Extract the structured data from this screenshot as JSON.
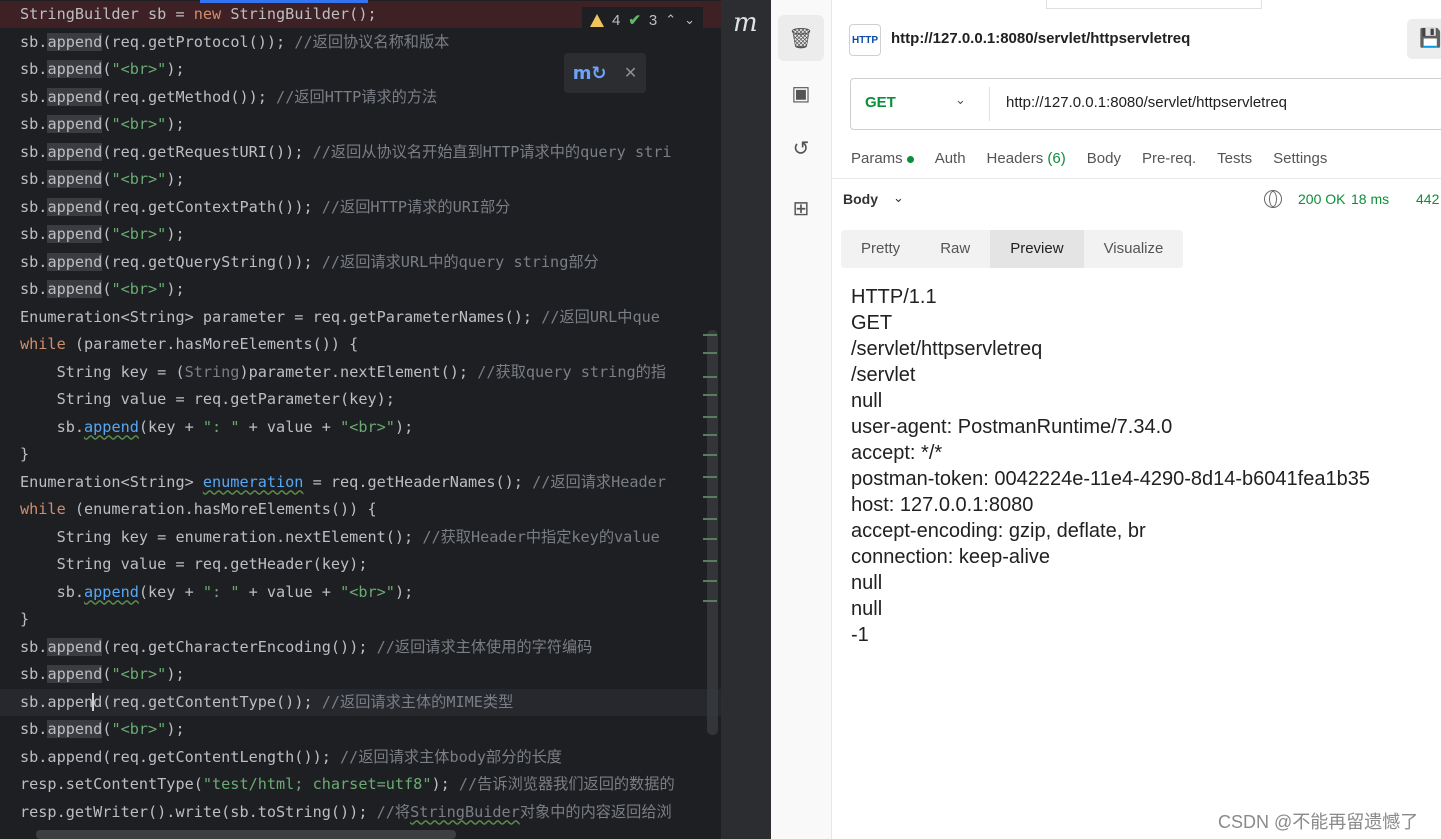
{
  "ide": {
    "inspections": {
      "warnings": "4",
      "weak_warnings": "3"
    },
    "popup": {
      "icon": "maven-refresh-icon"
    },
    "strip_label": "m"
  },
  "code_lines": [
    {
      "tokens": [
        {
          "t": "StringBuilder sb = "
        },
        {
          "t": "new",
          "c": "kw"
        },
        {
          "t": " StringBuilder();"
        }
      ]
    },
    {
      "tokens": [
        {
          "t": "sb."
        },
        {
          "t": "append",
          "c": "box"
        },
        {
          "t": "(req.getProtocol()); "
        },
        {
          "t": "//返回协议名称和版本",
          "c": "cm"
        }
      ]
    },
    {
      "tokens": [
        {
          "t": "sb."
        },
        {
          "t": "append",
          "c": "box"
        },
        {
          "t": "("
        },
        {
          "t": "\"<br>\"",
          "c": "str"
        },
        {
          "t": ");"
        }
      ]
    },
    {
      "tokens": [
        {
          "t": "sb."
        },
        {
          "t": "append",
          "c": "box"
        },
        {
          "t": "(req.getMethod()); "
        },
        {
          "t": "//返回HTTP请求的方法",
          "c": "cm"
        }
      ]
    },
    {
      "tokens": [
        {
          "t": "sb."
        },
        {
          "t": "append",
          "c": "box"
        },
        {
          "t": "("
        },
        {
          "t": "\"<br>\"",
          "c": "str"
        },
        {
          "t": ");"
        }
      ]
    },
    {
      "tokens": [
        {
          "t": "sb."
        },
        {
          "t": "append",
          "c": "box"
        },
        {
          "t": "(req.getRequestURI()); "
        },
        {
          "t": "//返回从协议名开始直到HTTP请求中的query stri",
          "c": "cm"
        }
      ]
    },
    {
      "tokens": [
        {
          "t": "sb."
        },
        {
          "t": "append",
          "c": "box"
        },
        {
          "t": "("
        },
        {
          "t": "\"<br>\"",
          "c": "str"
        },
        {
          "t": ");"
        }
      ]
    },
    {
      "tokens": [
        {
          "t": "sb."
        },
        {
          "t": "append",
          "c": "box"
        },
        {
          "t": "(req.getContextPath()); "
        },
        {
          "t": "//返回HTTP请求的URI部分",
          "c": "cm"
        }
      ]
    },
    {
      "tokens": [
        {
          "t": "sb."
        },
        {
          "t": "append",
          "c": "box"
        },
        {
          "t": "("
        },
        {
          "t": "\"<br>\"",
          "c": "str"
        },
        {
          "t": ");"
        }
      ]
    },
    {
      "tokens": [
        {
          "t": "sb."
        },
        {
          "t": "append",
          "c": "box"
        },
        {
          "t": "(req.getQueryString()); "
        },
        {
          "t": "//返回请求URL中的query string部分",
          "c": "cm"
        }
      ]
    },
    {
      "tokens": [
        {
          "t": "sb."
        },
        {
          "t": "append",
          "c": "box"
        },
        {
          "t": "("
        },
        {
          "t": "\"<br>\"",
          "c": "str"
        },
        {
          "t": ");"
        }
      ]
    },
    {
      "tokens": [
        {
          "t": "Enumeration<String> parameter = req.getParameterNames(); "
        },
        {
          "t": "//返回URL中que",
          "c": "cm"
        }
      ]
    },
    {
      "tokens": [
        {
          "t": "while",
          "c": "kw"
        },
        {
          "t": " (parameter.hasMoreElements()) {"
        }
      ]
    },
    {
      "tokens": [
        {
          "t": "    String key = ("
        },
        {
          "t": "String",
          "c": "gr"
        },
        {
          "t": ")parameter.nextElement(); "
        },
        {
          "t": "//获取query string的指",
          "c": "cm"
        }
      ]
    },
    {
      "tokens": [
        {
          "t": "    String value = req.getParameter(key);"
        }
      ]
    },
    {
      "tokens": [
        {
          "t": "    sb."
        },
        {
          "t": "append",
          "c": "ul"
        },
        {
          "t": "(key + "
        },
        {
          "t": "\": \"",
          "c": "str"
        },
        {
          "t": " + value + "
        },
        {
          "t": "\"<br>\"",
          "c": "str"
        },
        {
          "t": ");"
        }
      ]
    },
    {
      "tokens": [
        {
          "t": "}"
        }
      ]
    },
    {
      "tokens": [
        {
          "t": "Enumeration<String> "
        },
        {
          "t": "enumeration",
          "c": "ul"
        },
        {
          "t": " = req.getHeaderNames(); "
        },
        {
          "t": "//返回请求Header",
          "c": "cm"
        }
      ]
    },
    {
      "tokens": [
        {
          "t": "while",
          "c": "kw"
        },
        {
          "t": " (enumeration.hasMoreElements()) {"
        }
      ]
    },
    {
      "tokens": [
        {
          "t": "    String key = enumeration.nextElement(); "
        },
        {
          "t": "//获取Header中指定key的value",
          "c": "cm"
        }
      ]
    },
    {
      "tokens": [
        {
          "t": "    String value = req.getHeader(key);"
        }
      ]
    },
    {
      "tokens": [
        {
          "t": "    sb."
        },
        {
          "t": "append",
          "c": "ul"
        },
        {
          "t": "(key + "
        },
        {
          "t": "\": \"",
          "c": "str"
        },
        {
          "t": " + value + "
        },
        {
          "t": "\"<br>\"",
          "c": "str"
        },
        {
          "t": ");"
        }
      ]
    },
    {
      "tokens": [
        {
          "t": "}"
        }
      ]
    },
    {
      "tokens": [
        {
          "t": "sb."
        },
        {
          "t": "append",
          "c": "box"
        },
        {
          "t": "(req.getCharacterEncoding()); "
        },
        {
          "t": "//返回请求主体使用的字符编码",
          "c": "cm"
        }
      ]
    },
    {
      "tokens": [
        {
          "t": "sb."
        },
        {
          "t": "append",
          "c": "box"
        },
        {
          "t": "("
        },
        {
          "t": "\"<br>\"",
          "c": "str"
        },
        {
          "t": ");"
        }
      ]
    },
    {
      "tokens": [
        {
          "t": "sb.appen"
        },
        {
          "t": "",
          "c": "caret"
        },
        {
          "t": "d(req.getContentType()); "
        },
        {
          "t": "//返回请求主体的MIME类型",
          "c": "cm"
        }
      ]
    },
    {
      "tokens": [
        {
          "t": "sb."
        },
        {
          "t": "append",
          "c": "box"
        },
        {
          "t": "("
        },
        {
          "t": "\"<br>\"",
          "c": "str"
        },
        {
          "t": ");"
        }
      ]
    },
    {
      "tokens": [
        {
          "t": "sb.append(req.getContentLength()); "
        },
        {
          "t": "//返回请求主体body部分的长度",
          "c": "cm"
        }
      ]
    },
    {
      "tokens": [
        {
          "t": "resp.setContentType("
        },
        {
          "t": "\"test/html; charset=utf8\"",
          "c": "str"
        },
        {
          "t": "); "
        },
        {
          "t": "//告诉浏览器我们返回的数据的",
          "c": "cm"
        }
      ]
    },
    {
      "tokens": [
        {
          "t": "resp.getWriter().write(sb.toString()); "
        },
        {
          "t": "//将",
          "c": "cm"
        },
        {
          "t": "StringBuider",
          "c": "cm-ul"
        },
        {
          "t": "对象中的内容返回给浏",
          "c": "cm"
        }
      ]
    }
  ],
  "postman": {
    "request_title": "http://127.0.0.1:8080/servlet/httpservletreq",
    "http_icon_label": "HTTP",
    "method": "GET",
    "url": "http://127.0.0.1:8080/servlet/httpservletreq",
    "tabs": {
      "params": "Params",
      "auth": "Auth",
      "headers": "Headers",
      "headers_count": "(6)",
      "body": "Body",
      "prereq": "Pre-req.",
      "tests": "Tests",
      "settings": "Settings"
    },
    "response": {
      "body_label": "Body",
      "status": "200 OK",
      "time": "18 ms",
      "size": "442"
    },
    "view_tabs": {
      "pretty": "Pretty",
      "raw": "Raw",
      "preview": "Preview",
      "visualize": "Visualize"
    },
    "preview_lines": [
      "HTTP/1.1",
      "GET",
      "/servlet/httpservletreq",
      "/servlet",
      "null",
      "user-agent: PostmanRuntime/7.34.0",
      "accept: */*",
      "postman-token: 0042224e-11e4-4290-8d14-b6041fea1b35",
      "host: 127.0.0.1:8080",
      "accept-encoding: gzip, deflate, br",
      "connection: keep-alive",
      "null",
      "null",
      "-1"
    ]
  },
  "watermark": "CSDN @不能再留遗憾了",
  "colors": {
    "ide_bg": "#1e1f22",
    "keyword": "#cf8e6d",
    "string": "#6aab73",
    "comment": "#7a7e85",
    "postman_green": "#0b8f3a"
  }
}
